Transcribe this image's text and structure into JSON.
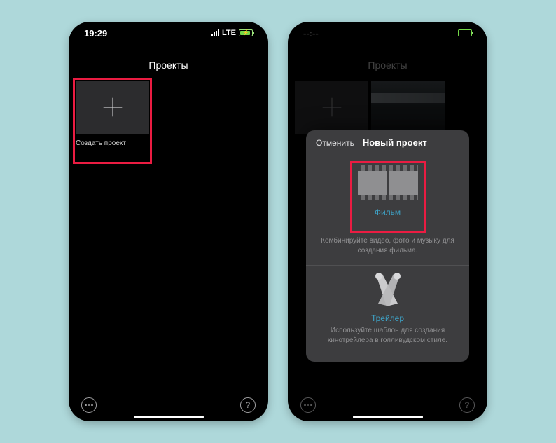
{
  "phones": {
    "left": {
      "status": {
        "time": "19:29",
        "network": "LTE"
      },
      "title": "Проекты",
      "create_label": "Создать проект"
    },
    "right": {
      "title": "Проекты",
      "modal": {
        "cancel": "Отменить",
        "title": "Новый проект",
        "movie": {
          "label": "Фильм",
          "desc": "Комбинируйте видео, фото и музыку для создания фильма."
        },
        "trailer": {
          "label": "Трейлер",
          "desc": "Используйте шаблон для создания кинотрейлера в голливудском стиле."
        }
      }
    }
  }
}
